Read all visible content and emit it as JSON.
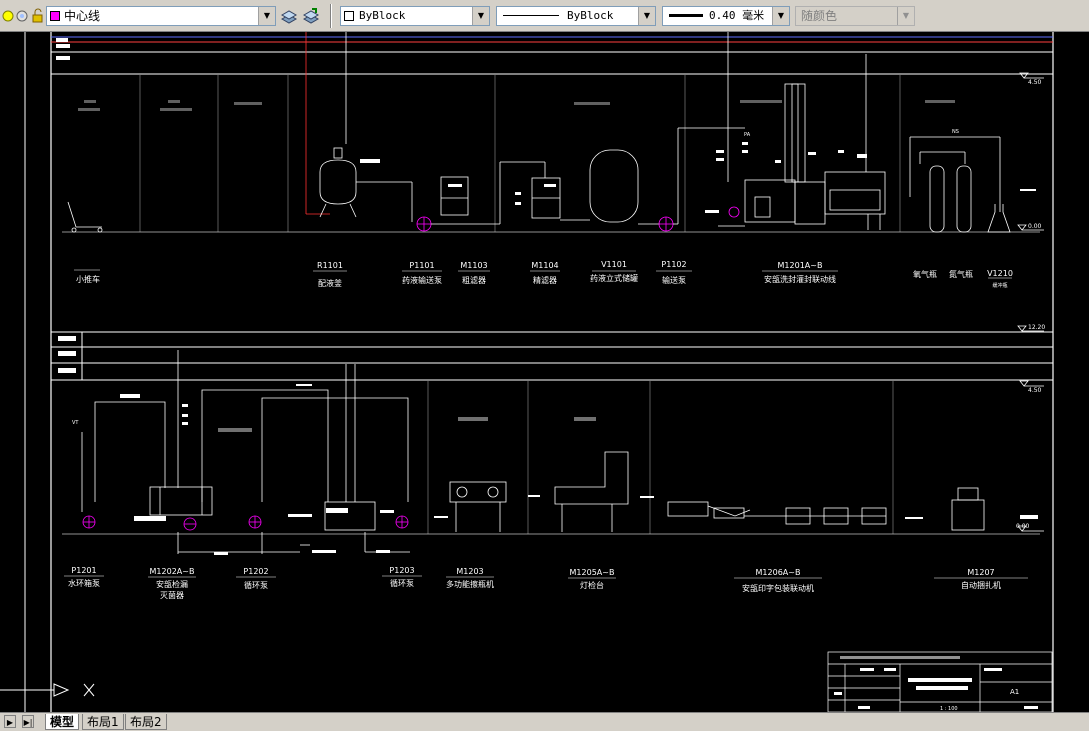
{
  "toolbar": {
    "layer_name": "中心线",
    "color_value": "ByBlock",
    "linetype_value": "ByBlock",
    "lineweight_value": "0.40 毫米",
    "plotstyle_value": "随颜色"
  },
  "drawing": {
    "top_row": {
      "elevations": [
        "4.50",
        "0.00",
        "12.20"
      ],
      "labels": [
        {
          "code": "",
          "name": "小推车"
        },
        {
          "code": "R1101",
          "name": "配液釜"
        },
        {
          "code": "P1101",
          "name": "药液输送泵"
        },
        {
          "code": "M1103",
          "name": "粗滤器"
        },
        {
          "code": "M1104",
          "name": "精滤器"
        },
        {
          "code": "V1101",
          "name": "药液立式储罐"
        },
        {
          "code": "P1102",
          "name": "输送泵"
        },
        {
          "code": "M1201A~B",
          "name": "安瓿洗封灌封联动线"
        },
        {
          "code": "",
          "name": "氧气瓶"
        },
        {
          "code": "",
          "name": "氮气瓶"
        },
        {
          "code": "V1210",
          "name": "缓冲瓶"
        }
      ],
      "process_tags": [
        "NS",
        "PA"
      ]
    },
    "bottom_row": {
      "elevations": [
        "4.50",
        "0.00"
      ],
      "labels": [
        {
          "code": "P1201",
          "name": "水环箱泵"
        },
        {
          "code": "M1202A~B",
          "name": "安瓿检漏",
          "name2": "灭菌器"
        },
        {
          "code": "P1202",
          "name": "循环泵"
        },
        {
          "code": "P1203",
          "name": "循环泵"
        },
        {
          "code": "M1203",
          "name": "多功能擦瓶机"
        },
        {
          "code": "M1205A~B",
          "name": "灯检台"
        },
        {
          "code": "M1206A~B",
          "name": "安瓿印字包装联动机"
        },
        {
          "code": "M1207",
          "name": "自动捆扎机"
        }
      ],
      "process_tags": [
        "VT"
      ]
    },
    "title_block": {
      "sheet_size": "A1",
      "scale": "1 : 100"
    }
  },
  "layout_tabs": [
    "模型",
    "布局1",
    "布局2"
  ],
  "colors": {
    "layer_swatch": "#ff00ff",
    "canvas": "#000000",
    "grid_line": "#808080",
    "magenta_pump": "#ff00ff",
    "red_pipe": "#ff3030"
  }
}
